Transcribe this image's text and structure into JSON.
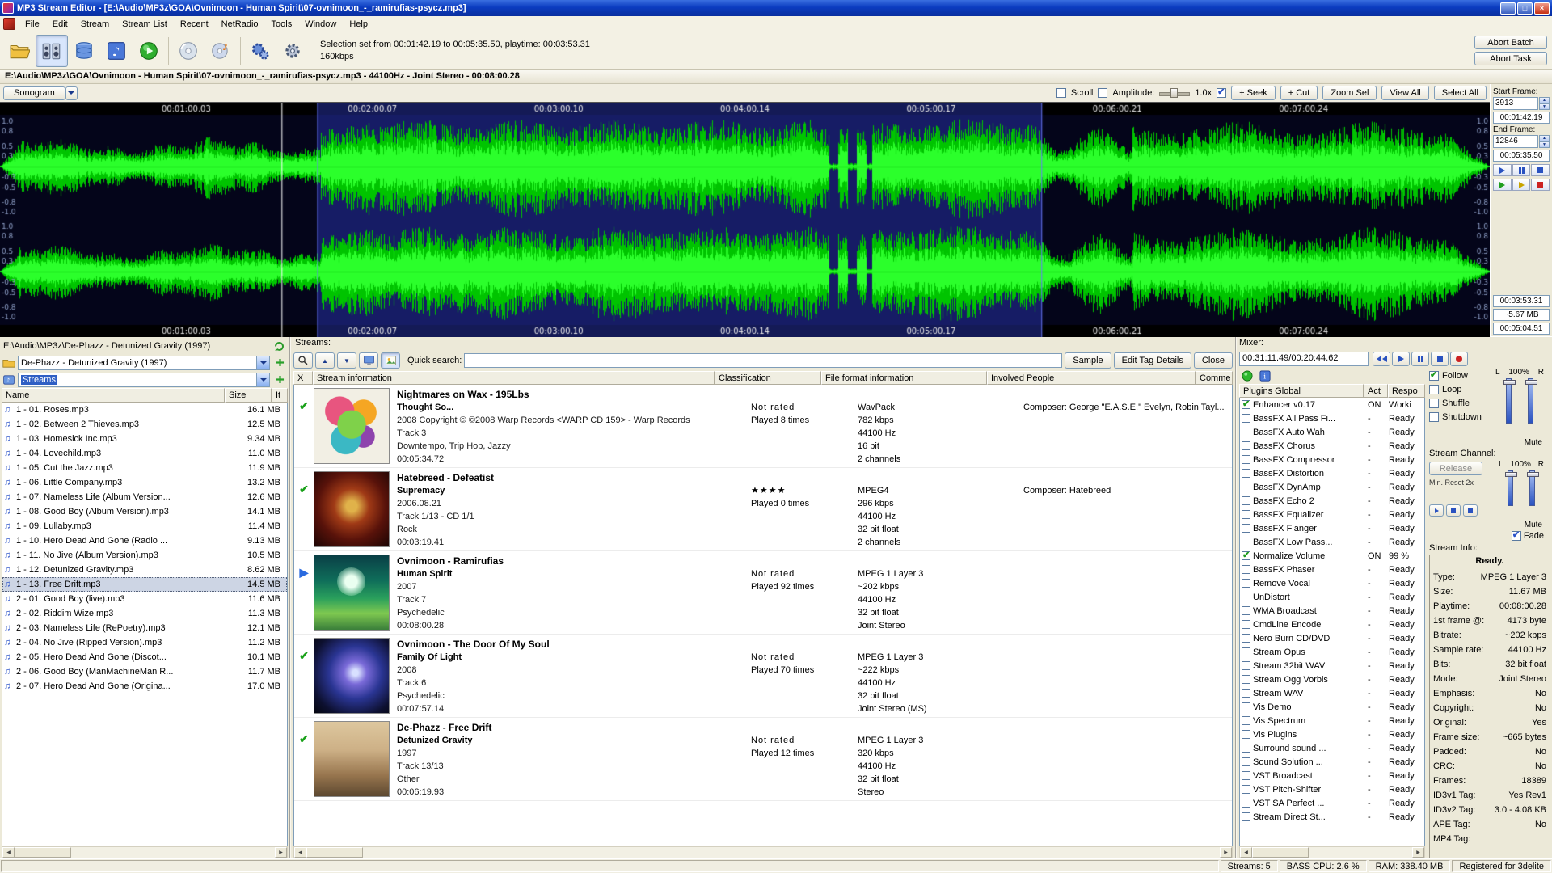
{
  "window": {
    "title": "MP3 Stream Editor - [E:\\Audio\\MP3z\\GOA\\Ovnimoon - Human Spirit\\07-ovnimoon_-_ramirufias-psycz.mp3]",
    "controls": {
      "minimize": "_",
      "maximize": "□",
      "close": "×"
    },
    "menu": [
      "File",
      "Edit",
      "Stream",
      "Stream List",
      "Recent",
      "NetRadio",
      "Tools",
      "Window",
      "Help"
    ]
  },
  "toolbar": {
    "status_line1": "Selection set from 00:01:42.19 to 00:05:35.50, playtime: 00:03:53.31",
    "status_line2": "160kbps",
    "abort_batch": "Abort Batch",
    "abort_task": "Abort Task"
  },
  "wave": {
    "header": "E:\\Audio\\MP3z\\GOA\\Ovnimoon - Human Spirit\\07-ovnimoon_-_ramirufias-psycz.mp3 - 44100Hz - Joint Stereo - 00:08:00.28",
    "sonogram": "Sonogram",
    "scroll_label": "Scroll",
    "scroll_checked": false,
    "amplitude_label": "Amplitude:",
    "amplitude_checked": false,
    "zoom_value": "1.0x",
    "snap_checked": true,
    "seek": "+ Seek",
    "cut": "+ Cut",
    "zoom_sel": "Zoom Sel",
    "view_all": "View All",
    "select_all": "Select All",
    "time_labels": [
      "00:01:00.03",
      "00:02:00.07",
      "00:03:00.10",
      "00:04:00.14",
      "00:05:00.17",
      "00:06:00.21",
      "00:07:00.24"
    ],
    "scale_labels": [
      "1.0",
      "0.8",
      "0.5",
      "0.3",
      "-0.3",
      "-0.5",
      "-0.8",
      "-1.0"
    ],
    "selection": {
      "start_pct": 21.3,
      "width_pct": 48.6,
      "playhead_pct": 18.9
    },
    "colors": {
      "bg": "#04051a",
      "ruler": "#000000",
      "green": "#00c400",
      "bright": "#2bff2b",
      "center": "#00b400",
      "scale_text": "#8fa0c8",
      "time_text": "#e8e8e8",
      "selection": "rgba(48,62,205,0.42)",
      "selection_edge": "#6a7aff",
      "playhead": "#ffffff"
    }
  },
  "frame_panel": {
    "start_frame_label": "Start Frame:",
    "start_frame": "3913",
    "start_time": "00:01:42.19",
    "end_frame_label": "End Frame:",
    "end_frame": "12846",
    "end_time": "00:05:35.50",
    "sel_playtime": "00:03:53.31",
    "sel_size": "~5.67 MB",
    "remain_time": "00:05:04.51"
  },
  "browser": {
    "path": "E:\\Audio\\MP3z\\De-Phazz - Detunized Gravity (1997)",
    "folder_combo": "De-Phazz - Detunized Gravity (1997)",
    "view_combo": "Streams",
    "col_name": "Name",
    "col_size": "Size",
    "col_it": "It",
    "files": [
      {
        "name": "1 - 01. Roses.mp3",
        "size": "16.1 MB"
      },
      {
        "name": "1 - 02. Between 2 Thieves.mp3",
        "size": "12.5 MB"
      },
      {
        "name": "1 - 03. Homesick Inc.mp3",
        "size": "9.34 MB"
      },
      {
        "name": "1 - 04. Lovechild.mp3",
        "size": "11.0 MB"
      },
      {
        "name": "1 - 05. Cut the Jazz.mp3",
        "size": "11.9 MB"
      },
      {
        "name": "1 - 06. Little Company.mp3",
        "size": "13.2 MB"
      },
      {
        "name": "1 - 07. Nameless Life (Album Version...",
        "size": "12.6 MB"
      },
      {
        "name": "1 - 08. Good Boy (Album Version).mp3",
        "size": "14.1 MB"
      },
      {
        "name": "1 - 09. Lullaby.mp3",
        "size": "11.4 MB"
      },
      {
        "name": "1 - 10. Hero Dead And Gone (Radio ...",
        "size": "9.13 MB"
      },
      {
        "name": "1 - 11. No Jive (Album Version).mp3",
        "size": "10.5 MB"
      },
      {
        "name": "1 - 12. Detunized Gravity.mp3",
        "size": "8.62 MB"
      },
      {
        "name": "1 - 13. Free Drift.mp3",
        "size": "14.5 MB",
        "selected": true
      },
      {
        "name": "2 - 01. Good Boy (live).mp3",
        "size": "11.6 MB"
      },
      {
        "name": "2 - 02. Riddim Wize.mp3",
        "size": "11.3 MB"
      },
      {
        "name": "2 - 03. Nameless Life (RePoetry).mp3",
        "size": "12.1 MB"
      },
      {
        "name": "2 - 04. No Jive (Ripped Version).mp3",
        "size": "11.2 MB"
      },
      {
        "name": "2 - 05. Hero Dead And Gone (Discot...",
        "size": "10.1 MB"
      },
      {
        "name": "2 - 06. Good Boy (ManMachineMan R...",
        "size": "11.7 MB"
      },
      {
        "name": "2 - 07. Hero Dead And Gone (Origina...",
        "size": "17.0 MB"
      }
    ]
  },
  "streams_panel": {
    "label": "Streams:",
    "quick_search_label": "Quick search:",
    "search_value": "",
    "sample": "Sample",
    "edit_tag": "Edit Tag Details",
    "close": "Close",
    "col_x": "X",
    "col_info": "Stream information",
    "col_class": "Classification",
    "col_format": "File format information",
    "col_people": "Involved People",
    "col_comments": "Comme",
    "rows": [
      {
        "status": "check",
        "art": "nightmares-on-wax",
        "title": "Nightmares on Wax - 195Lbs",
        "album": "Thought So...",
        "details": [
          "2008 Copyright © ©2008 Warp Records <WARP CD 159> - Warp Records",
          "Track 3",
          "Downtempo, Trip Hop, Jazzy",
          "00:05:34.72"
        ],
        "rating": "Not rated",
        "played": "Played 8 times",
        "format": [
          "WavPack",
          "782 kbps",
          "44100 Hz",
          "16 bit",
          "2 channels"
        ],
        "people": "Composer: George \"E.A.S.E.\" Evelyn, Robin Tayl..."
      },
      {
        "status": "check",
        "art": "hatebreed-supremacy",
        "title": "Hatebreed - Defeatist",
        "album": "Supremacy",
        "details": [
          "2006.08.21",
          "Track 1/13 - CD 1/1",
          "Rock",
          "00:03:19.41"
        ],
        "rating": "★★★★",
        "played": "Played 0 times",
        "format": [
          "MPEG4",
          "296 kbps",
          "44100 Hz",
          "32 bit float",
          "2 channels"
        ],
        "people": "Composer: Hatebreed"
      },
      {
        "status": "play",
        "art": "ovnimoon-human-spirit",
        "title": "Ovnimoon - Ramirufias",
        "album": "Human Spirit",
        "details": [
          "2007",
          "Track 7",
          "Psychedelic",
          "00:08:00.28"
        ],
        "rating": "Not rated",
        "played": "Played 92 times",
        "format": [
          "MPEG 1 Layer 3",
          "~202 kbps",
          "44100 Hz",
          "32 bit float",
          "Joint Stereo"
        ],
        "people": ""
      },
      {
        "status": "check",
        "art": "ovnimoon-door",
        "title": "Ovnimoon - The Door Of My Soul",
        "album": "Family Of Light",
        "details": [
          "2008",
          "Track 6",
          "Psychedelic",
          "00:07:57.14"
        ],
        "rating": "Not rated",
        "played": "Played 70 times",
        "format": [
          "MPEG 1 Layer 3",
          "~222 kbps",
          "44100 Hz",
          "32 bit float",
          "Joint Stereo (MS)"
        ],
        "people": ""
      },
      {
        "status": "check",
        "art": "dephazz-detunized",
        "title": "De-Phazz - Free Drift",
        "album": "Detunized Gravity",
        "details": [
          "1997",
          "Track 13/13",
          "Other",
          "00:06:19.93"
        ],
        "rating": "Not rated",
        "played": "Played 12 times",
        "format": [
          "MPEG 1 Layer 3",
          "320 kbps",
          "44100 Hz",
          "32 bit float",
          "Stereo"
        ],
        "people": ""
      }
    ]
  },
  "mixer": {
    "label": "Mixer:",
    "time": "00:31:11.49/00:20:44.62",
    "l_label": "L",
    "volume": "100%",
    "r_label": "R",
    "mute_label": "Mute",
    "checks": [
      {
        "label": "Follow",
        "checked": true
      },
      {
        "label": "Loop",
        "checked": false
      },
      {
        "label": "Shuffle",
        "checked": false
      },
      {
        "label": "Shutdown",
        "checked": false
      }
    ],
    "stream_channel_label": "Stream Channel:",
    "release": "Release",
    "min_reset": "Min. Reset 2x",
    "ch_l": "L",
    "ch_volume": "100%",
    "ch_r": "R",
    "ch_mute": "Mute",
    "fade_label": "Fade",
    "fade_checked": true
  },
  "plugins": {
    "col_name": "Plugins Global",
    "col_act": "Act",
    "col_resp": "Respo",
    "rows": [
      {
        "name": "Enhancer v0.17",
        "checked": true,
        "act": "ON",
        "resp": "Worki"
      },
      {
        "name": "BassFX All Pass Fi...",
        "checked": false,
        "act": "-",
        "resp": "Ready"
      },
      {
        "name": "BassFX Auto Wah",
        "checked": false,
        "act": "-",
        "resp": "Ready"
      },
      {
        "name": "BassFX Chorus",
        "checked": false,
        "act": "-",
        "resp": "Ready"
      },
      {
        "name": "BassFX Compressor",
        "checked": false,
        "act": "-",
        "resp": "Ready"
      },
      {
        "name": "BassFX Distortion",
        "checked": false,
        "act": "-",
        "resp": "Ready"
      },
      {
        "name": "BassFX DynAmp",
        "checked": false,
        "act": "-",
        "resp": "Ready"
      },
      {
        "name": "BassFX Echo 2",
        "checked": false,
        "act": "-",
        "resp": "Ready"
      },
      {
        "name": "BassFX Equalizer",
        "checked": false,
        "act": "-",
        "resp": "Ready"
      },
      {
        "name": "BassFX Flanger",
        "checked": false,
        "act": "-",
        "resp": "Ready"
      },
      {
        "name": "BassFX Low Pass...",
        "checked": false,
        "act": "-",
        "resp": "Ready"
      },
      {
        "name": "Normalize Volume",
        "checked": true,
        "act": "ON",
        "resp": "99 %"
      },
      {
        "name": "BassFX Phaser",
        "checked": false,
        "act": "-",
        "resp": "Ready"
      },
      {
        "name": "Remove Vocal",
        "checked": false,
        "act": "-",
        "resp": "Ready"
      },
      {
        "name": "UnDistort",
        "checked": false,
        "act": "-",
        "resp": "Ready"
      },
      {
        "name": "WMA Broadcast",
        "checked": false,
        "act": "-",
        "resp": "Ready"
      },
      {
        "name": "CmdLine Encode",
        "checked": false,
        "act": "-",
        "resp": "Ready"
      },
      {
        "name": "Nero Burn CD/DVD",
        "checked": false,
        "act": "-",
        "resp": "Ready"
      },
      {
        "name": "Stream Opus",
        "checked": false,
        "act": "-",
        "resp": "Ready"
      },
      {
        "name": "Stream 32bit WAV",
        "checked": false,
        "act": "-",
        "resp": "Ready"
      },
      {
        "name": "Stream Ogg Vorbis",
        "checked": false,
        "act": "-",
        "resp": "Ready"
      },
      {
        "name": "Stream WAV",
        "checked": false,
        "act": "-",
        "resp": "Ready"
      },
      {
        "name": "Vis Demo",
        "checked": false,
        "act": "-",
        "resp": "Ready"
      },
      {
        "name": "Vis Spectrum",
        "checked": false,
        "act": "-",
        "resp": "Ready"
      },
      {
        "name": "Vis Plugins",
        "checked": false,
        "act": "-",
        "resp": "Ready"
      },
      {
        "name": "Surround sound ...",
        "checked": false,
        "act": "-",
        "resp": "Ready"
      },
      {
        "name": "Sound Solution ...",
        "checked": false,
        "act": "-",
        "resp": "Ready"
      },
      {
        "name": "VST Broadcast",
        "checked": false,
        "act": "-",
        "resp": "Ready"
      },
      {
        "name": "VST Pitch-Shifter",
        "checked": false,
        "act": "-",
        "resp": "Ready"
      },
      {
        "name": "VST SA Perfect ...",
        "checked": false,
        "act": "-",
        "resp": "Ready"
      },
      {
        "name": "Stream Direct St...",
        "checked": false,
        "act": "-",
        "resp": "Ready"
      }
    ]
  },
  "stream_info": {
    "label": "Stream Info:",
    "status": "Ready.",
    "rows": [
      {
        "k": "Type:",
        "v": "MPEG 1 Layer 3"
      },
      {
        "k": "Size:",
        "v": "11.67 MB"
      },
      {
        "k": "Playtime:",
        "v": "00:08:00.28"
      },
      {
        "k": "1st frame @:",
        "v": "4173 byte"
      },
      {
        "k": "Bitrate:",
        "v": "~202 kbps"
      },
      {
        "k": "Sample rate:",
        "v": "44100 Hz"
      },
      {
        "k": "Bits:",
        "v": "32 bit float"
      },
      {
        "k": "Mode:",
        "v": "Joint Stereo"
      },
      {
        "k": "Emphasis:",
        "v": "No"
      },
      {
        "k": "Copyright:",
        "v": "No"
      },
      {
        "k": "Original:",
        "v": "Yes"
      },
      {
        "k": "Frame size:",
        "v": "~665 bytes"
      },
      {
        "k": "Padded:",
        "v": "No"
      },
      {
        "k": "CRC:",
        "v": "No"
      },
      {
        "k": "Frames:",
        "v": "18389"
      },
      {
        "k": "ID3v1 Tag:",
        "v": "Yes Rev1"
      },
      {
        "k": "ID3v2 Tag:",
        "v": "3.0 - 4.08 KB"
      },
      {
        "k": "APE Tag:",
        "v": "No"
      },
      {
        "k": "MP4 Tag:",
        "v": ""
      }
    ]
  },
  "status_bar": {
    "streams": "Streams: 5",
    "cpu": "BASS CPU: 2.6 %",
    "ram": "RAM: 338.40 MB",
    "registered": "Registered for 3delite"
  }
}
